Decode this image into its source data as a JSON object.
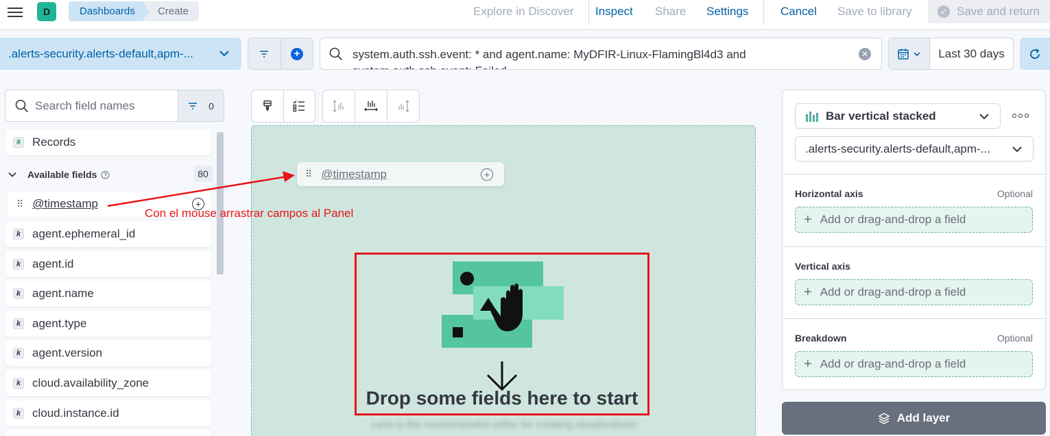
{
  "header": {
    "space_initial": "D",
    "breadcrumbs": [
      "Dashboards",
      "Create"
    ],
    "links": {
      "explore": "Explore in Discover",
      "inspect": "Inspect",
      "share": "Share",
      "settings": "Settings",
      "cancel": "Cancel",
      "save_library": "Save to library",
      "save_return": "Save and return"
    },
    "colors": {
      "link": "#0061a6",
      "disabled": "#a2abba"
    }
  },
  "querybar": {
    "data_view": ".alerts-security.alerts-default,apm-...",
    "query": "system.auth.ssh.event: * and agent.name: MyDFIR-Linux-FlamingBl4d3 and system.auth.ssh.event: Failed",
    "date_range": "Last 30 days"
  },
  "sidebar": {
    "search_placeholder": "Search field names",
    "filter_count": "0",
    "records_label": "Records",
    "available_label": "Available fields",
    "available_count": "80",
    "dragging_field": "@timestamp",
    "fields": [
      "agent.ephemeral_id",
      "agent.id",
      "agent.name",
      "agent.type",
      "agent.version",
      "cloud.availability_zone",
      "cloud.instance.id"
    ]
  },
  "workspace": {
    "drag_ghost_label": "@timestamp",
    "annotation": "Con el mouse arrastrar campos al Panel",
    "drop_title": "Drop some fields here to start",
    "drop_subtitle": "Lens is the recommended editor for creating visualizations"
  },
  "config": {
    "chart_type": "Bar vertical stacked",
    "data_view": ".alerts-security.alerts-default,apm-...",
    "sections": [
      {
        "title": "Horizontal axis",
        "optional": "Optional",
        "placeholder": "Add or drag-and-drop a field"
      },
      {
        "title": "Vertical axis",
        "optional": "",
        "placeholder": "Add or drag-and-drop a field"
      },
      {
        "title": "Breakdown",
        "optional": "Optional",
        "placeholder": "Add or drag-and-drop a field"
      }
    ],
    "add_layer": "Add layer"
  }
}
